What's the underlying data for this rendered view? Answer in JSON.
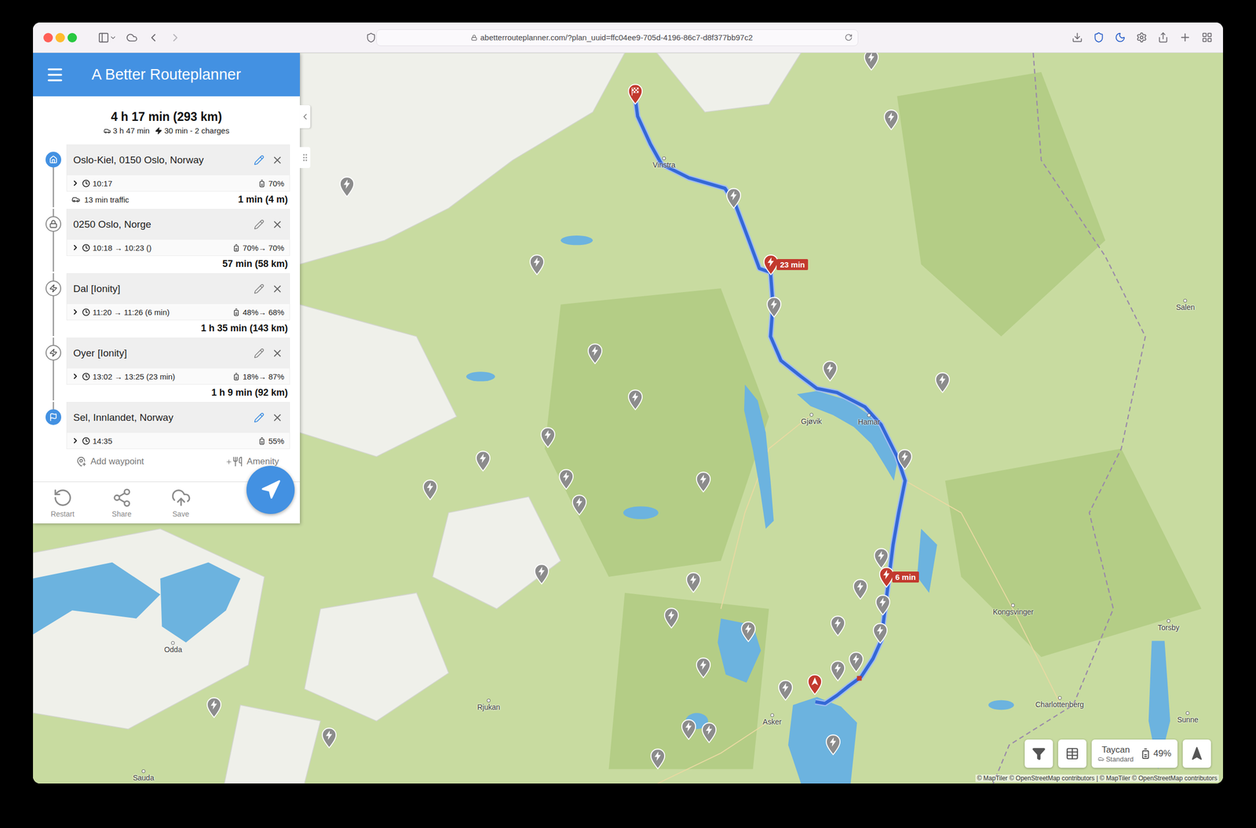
{
  "browser": {
    "url": "abetterrouteplanner.com/?plan_uuid=ffc04ee9-705d-4196-86c7-d8f377bb97c2"
  },
  "app": {
    "title": "A Better Routeplanner"
  },
  "summary": {
    "total": "4 h 17 min (293 km)",
    "drive": "3 h 47 min",
    "charge": "30 min - 2 charges"
  },
  "waypoints": [
    {
      "kind": "start",
      "name": "Oslo-Kiel, 0150 Oslo, Norway",
      "time": "10:17",
      "battery": "70%",
      "traffic": "13 min traffic",
      "leg": "1 min (4 m)"
    },
    {
      "kind": "stop",
      "name": "0250 Oslo, Norge",
      "time": "10:18 → 10:23 ()",
      "battery": "70%→ 70%",
      "leg": "57 min (58 km)"
    },
    {
      "kind": "charger",
      "name": "Dal [Ionity]",
      "time": "11:20 → 11:26 (6 min)",
      "battery": "48%→ 68%",
      "leg": "1 h 35 min (143 km)"
    },
    {
      "kind": "charger",
      "name": "Oyer [Ionity]",
      "time": "13:02 → 13:25 (23 min)",
      "battery": "18%→ 87%",
      "leg": "1 h 9 min (92 km)"
    },
    {
      "kind": "end",
      "name": "Sel, Innlandet, Norway",
      "time": "14:35",
      "battery": "55%"
    }
  ],
  "actions": {
    "add_waypoint": "Add waypoint",
    "amenity": "Amenity"
  },
  "bottom_bar": [
    {
      "label": "Restart"
    },
    {
      "label": "Share"
    },
    {
      "label": "Save"
    }
  ],
  "map": {
    "labels": [
      "Vinstra",
      "Gjøvik",
      "Hamar",
      "Salen",
      "Kongsvinger",
      "Torsby",
      "Charlottenberg",
      "Sunne",
      "Asker",
      "Odda",
      "Rjukan",
      "Sauda"
    ],
    "route_badges": [
      "23 min",
      "6 min"
    ],
    "attribution": "© MapTiler © OpenStreetMap contributors | © MapTiler © OpenStreetMap contributors"
  },
  "vehicle": {
    "name": "Taycan",
    "variant": "Standard",
    "battery": "49%"
  }
}
